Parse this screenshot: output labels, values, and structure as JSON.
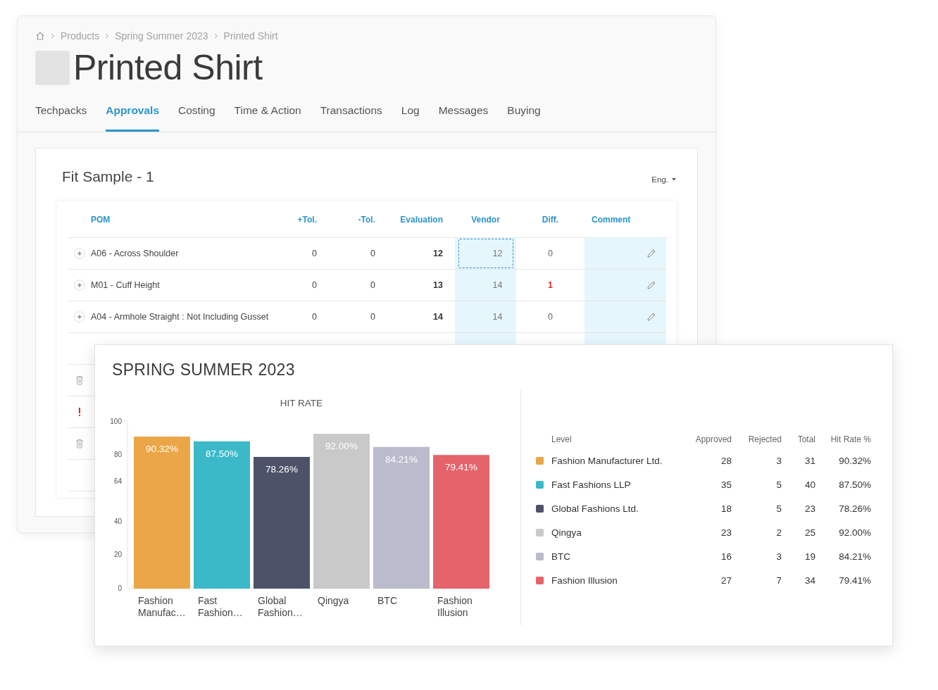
{
  "breadcrumb": [
    "Products",
    "Spring Summer 2023",
    "Printed Shirt"
  ],
  "title": "Printed Shirt",
  "tabs": [
    {
      "label": "Techpacks",
      "selected": false
    },
    {
      "label": "Approvals",
      "selected": true
    },
    {
      "label": "Costing",
      "selected": false
    },
    {
      "label": "Time & Action",
      "selected": false
    },
    {
      "label": "Transactions",
      "selected": false
    },
    {
      "label": "Log",
      "selected": false
    },
    {
      "label": "Messages",
      "selected": false
    },
    {
      "label": "Buying",
      "selected": false
    }
  ],
  "sample": {
    "title": "Fit Sample - 1",
    "language": "Eng."
  },
  "table": {
    "columns": [
      "POM",
      "+Tol.",
      "-Tol.",
      "Evaluation",
      "Vendor",
      "Diff.",
      "Comment"
    ],
    "rows": [
      {
        "kind": "expand",
        "pom": "A06 - Across Shoulder",
        "plus_tol": "0",
        "minus_tol": "0",
        "evaluation": "12",
        "vendor": "12",
        "vendor_focused": true,
        "diff": "0",
        "diff_flagged": false
      },
      {
        "kind": "expand",
        "pom": "M01 - Cuff Height",
        "plus_tol": "0",
        "minus_tol": "0",
        "evaluation": "13",
        "vendor": "14",
        "vendor_focused": false,
        "diff": "1",
        "diff_flagged": true
      },
      {
        "kind": "expand",
        "pom": "A04 - Armhole Straight : Not Including Gusset",
        "plus_tol": "0",
        "minus_tol": "0",
        "evaluation": "14",
        "vendor": "14",
        "vendor_focused": false,
        "diff": "0",
        "diff_flagged": false
      },
      {
        "kind": "plain"
      },
      {
        "kind": "trash"
      },
      {
        "kind": "alert"
      },
      {
        "kind": "trash"
      },
      {
        "kind": "plain"
      }
    ]
  },
  "report": {
    "title": "SPRING SUMMER 2023",
    "chart_data": {
      "type": "bar",
      "title": "HIT RATE",
      "categories": [
        "Fashion Manufac…",
        "Fast Fashion…",
        "Global Fashion…",
        "Qingya",
        "BTC",
        "Fashion Illusion"
      ],
      "values": [
        90.32,
        87.5,
        78.26,
        92.0,
        84.21,
        79.41
      ],
      "ylim": [
        0,
        100
      ],
      "yticks": [
        0,
        20,
        40,
        64,
        80,
        100
      ],
      "value_labels": [
        "90.32%",
        "87.50%",
        "78.26%",
        "92.00%",
        "84.21%",
        "79.41%"
      ]
    },
    "legend": {
      "columns": [
        "Level",
        "Approved",
        "Rejected",
        "Total",
        "Hit Rate %"
      ],
      "rows": [
        {
          "name": "Fashion Manufacturer Ltd.",
          "color": "#eba647",
          "approved": "28",
          "rejected": "3",
          "total": "31",
          "hit_rate": "90.32%"
        },
        {
          "name": "Fast Fashions LLP",
          "color": "#3bb9c9",
          "approved": "35",
          "rejected": "5",
          "total": "40",
          "hit_rate": "87.50%"
        },
        {
          "name": "Global Fashions Ltd.",
          "color": "#4d5268",
          "approved": "18",
          "rejected": "5",
          "total": "23",
          "hit_rate": "78.26%"
        },
        {
          "name": "Qingya",
          "color": "#c9c9c9",
          "approved": "23",
          "rejected": "2",
          "total": "25",
          "hit_rate": "92.00%"
        },
        {
          "name": "BTC",
          "color": "#babbcc",
          "approved": "16",
          "rejected": "3",
          "total": "19",
          "hit_rate": "84.21%"
        },
        {
          "name": "Fashion Illusion",
          "color": "#e5636a",
          "approved": "27",
          "rejected": "7",
          "total": "34",
          "hit_rate": "79.41%"
        }
      ]
    }
  }
}
